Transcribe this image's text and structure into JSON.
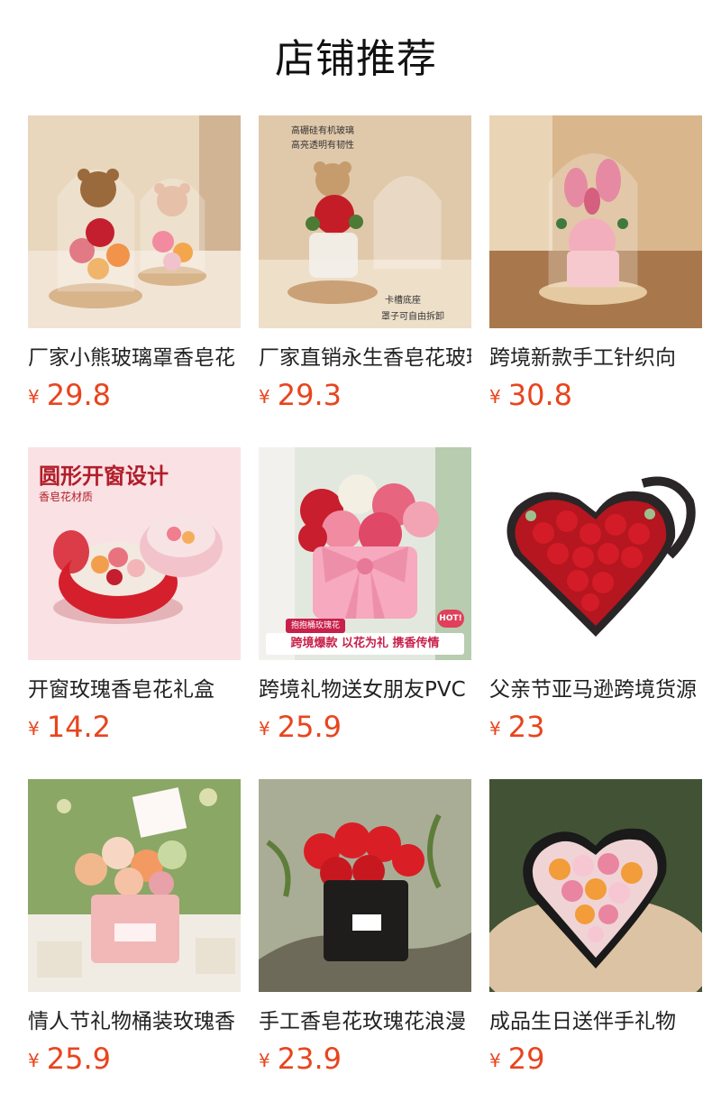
{
  "section": {
    "title": "店铺推荐"
  },
  "colors": {
    "price": "#e8451e",
    "title": "#111111"
  },
  "products": [
    {
      "name": "厂家小熊玻璃罩香皂花",
      "currency": "¥",
      "price": "29.8",
      "image": "teddy-bears-glass-dome-roses",
      "image_text": []
    },
    {
      "name": "厂家直销永生香皂花玻璃罩",
      "currency": "¥",
      "price": "29.3",
      "image": "teddy-bear-red-rose-glass-dome",
      "image_text": [
        "高硼硅有机玻璃",
        "高亮透明有韧性",
        "卡槽底座",
        "罩子可自由拆卸"
      ]
    },
    {
      "name": "跨境新款手工针织向",
      "currency": "¥",
      "price": "30.8",
      "image": "knitted-tulips-glass-dome",
      "image_text": []
    },
    {
      "name": "开窗玫瑰香皂花礼盒",
      "currency": "¥",
      "price": "14.2",
      "image": "round-window-gift-box",
      "image_text": [
        "圆形开窗设计",
        "香皂花材质"
      ]
    },
    {
      "name": "跨境礼物送女朋友PVC",
      "currency": "¥",
      "price": "25.9",
      "image": "pink-bow-rose-bucket",
      "image_text": [
        "跨境爆款 以花为礼 携香传情",
        "抱抱桶玫瑰花",
        "HOT!"
      ]
    },
    {
      "name": "父亲节亚马逊跨境货源",
      "currency": "¥",
      "price": "23",
      "image": "heart-box-red-roses",
      "image_text": []
    },
    {
      "name": "情人节礼物桶装玫瑰香",
      "currency": "¥",
      "price": "25.9",
      "image": "pink-bucket-pastel-flowers",
      "image_text": []
    },
    {
      "name": "手工香皂花玫瑰花浪漫",
      "currency": "¥",
      "price": "23.9",
      "image": "black-box-red-roses",
      "image_text": []
    },
    {
      "name": "成品生日送伴手礼物",
      "currency": "¥",
      "price": "29",
      "image": "heart-box-pastel-roses",
      "image_text": []
    }
  ]
}
